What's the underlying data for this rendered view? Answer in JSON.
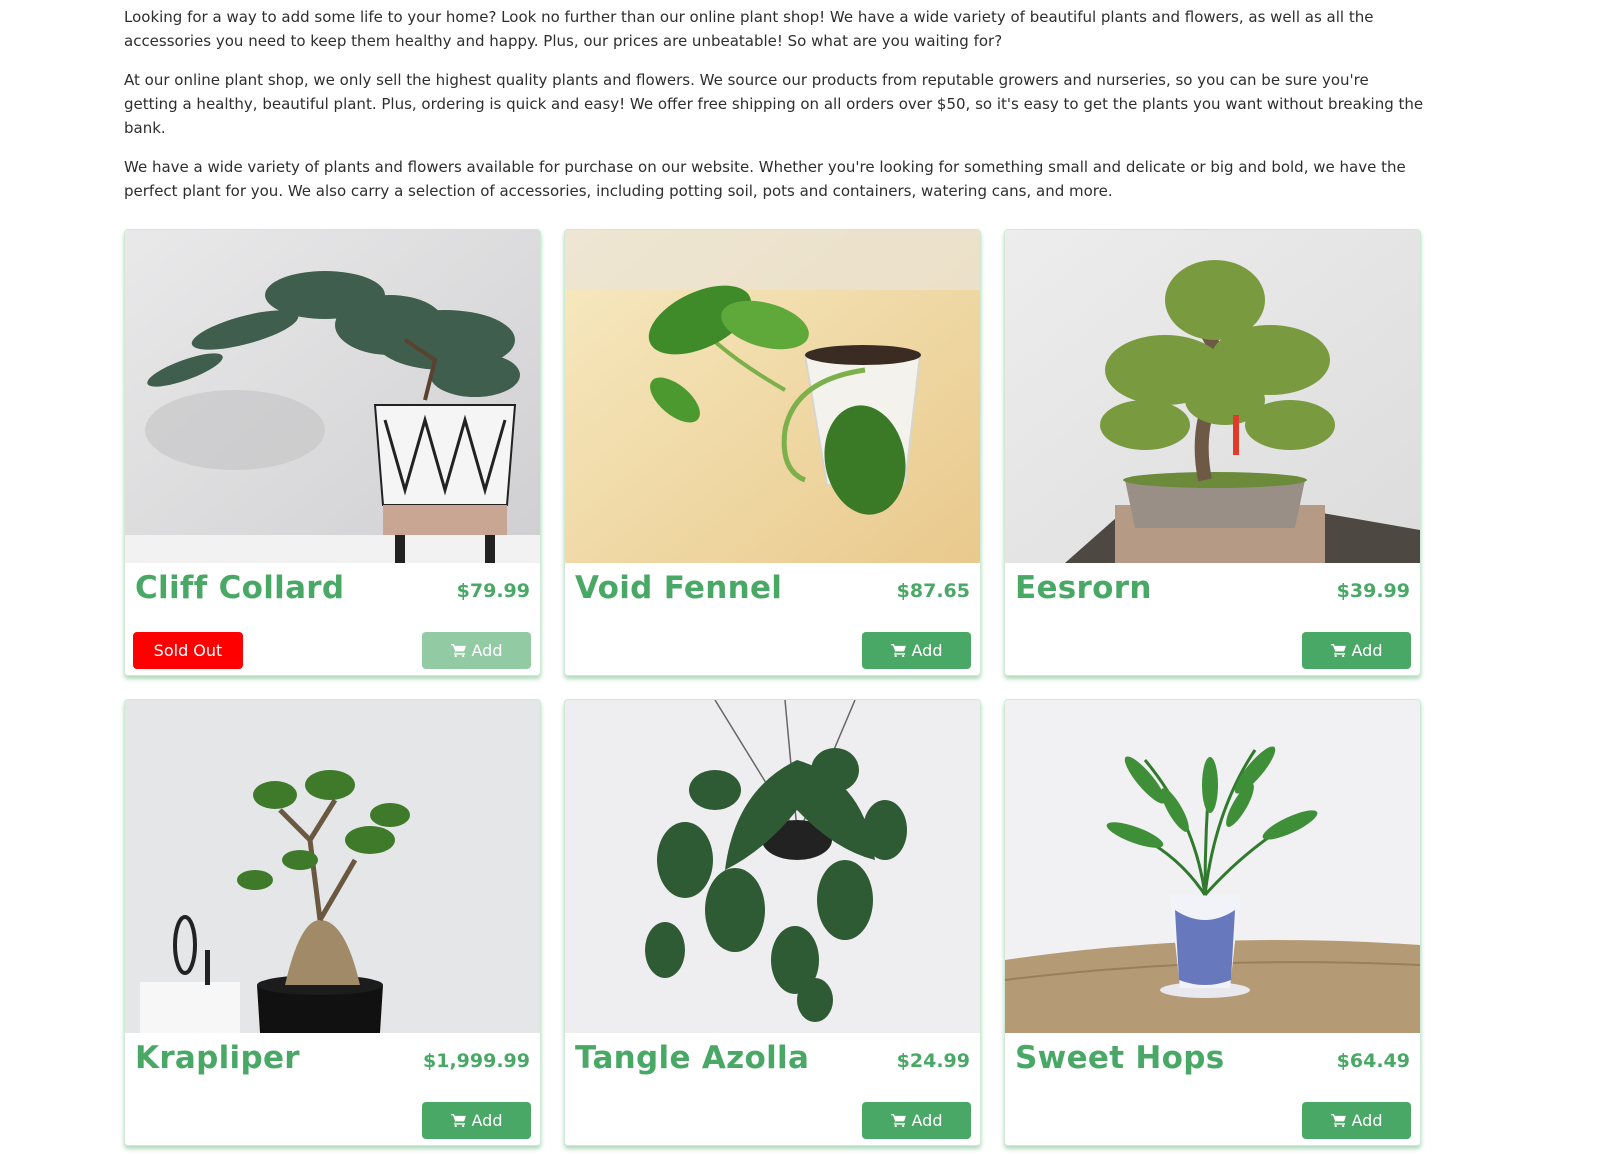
{
  "intro": {
    "p1": "Looking for a way to add some life to your home? Look no further than our online plant shop! We have a wide variety of beautiful plants and flowers, as well as all the accessories you need to keep them healthy and happy. Plus, our prices are unbeatable! So what are you waiting for?",
    "p2": "At our online plant shop, we only sell the highest quality plants and flowers. We source our products from reputable growers and nurseries, so you can be sure you're getting a healthy, beautiful plant. Plus, ordering is quick and easy! We offer free shipping on all orders over $50, so it's easy to get the plants you want without breaking the bank.",
    "p3": "We have a wide variety of plants and flowers available for purchase on our website. Whether you're looking for something small and delicate or big and bold, we have the perfect plant for you. We also carry a selection of accessories, including potting soil, pots and containers, watering cans, and more."
  },
  "products": [
    {
      "name": "Cliff Collard",
      "price": "$79.99",
      "add_label": "Add",
      "sold_out_label": "Sold Out",
      "image": "juniper-bonsai-in-patterned-pot"
    },
    {
      "name": "Void Fennel",
      "price": "$87.65",
      "add_label": "Add",
      "image": "pothos-cutting-in-white-pot"
    },
    {
      "name": "Eesrorn",
      "price": "$39.99",
      "add_label": "Add",
      "image": "bonsai-tree-in-clay-tray"
    },
    {
      "name": "Krapliper",
      "price": "$1,999.99",
      "add_label": "Add",
      "image": "ginseng-ficus-bonsai"
    },
    {
      "name": "Tangle Azolla",
      "price": "$24.99",
      "add_label": "Add",
      "image": "hanging-philodendron"
    },
    {
      "name": "Sweet Hops",
      "price": "$64.49",
      "add_label": "Add",
      "image": "parlor-palm-in-blue-pot"
    }
  ],
  "colors": {
    "accent": "#4aa866",
    "accent_disabled": "#92cba3",
    "sold_out": "#ff0000"
  }
}
